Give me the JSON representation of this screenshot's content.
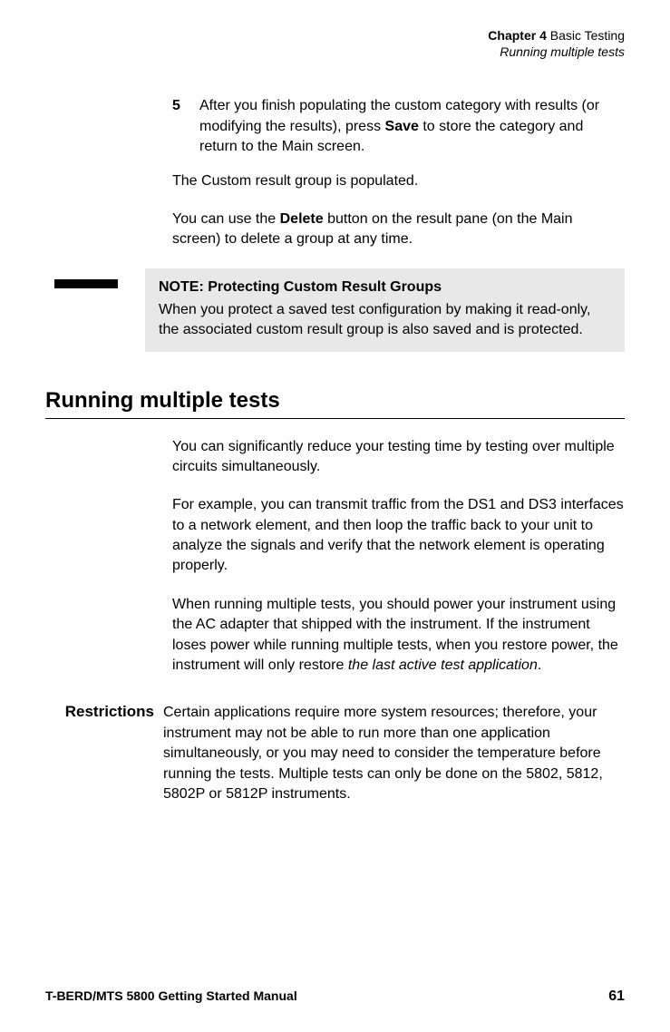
{
  "header": {
    "chapter_label": "Chapter 4",
    "chapter_title": "Basic Testing",
    "section_title": "Running multiple tests"
  },
  "step5": {
    "number": "5",
    "text_before_save": "After you finish populating the custom category with results (or modifying the results), press ",
    "save_word": "Save",
    "text_after_save": " to store the category and return to the Main screen."
  },
  "populated_text": "The Custom result group is populated.",
  "delete_para": {
    "before": "You can use the ",
    "delete_word": "Delete",
    "after": " button on the result pane (on the Main screen) to delete a group at any time."
  },
  "note": {
    "title": "NOTE: Protecting Custom Result Groups",
    "body": "When you protect a saved test configuration by making it read-only, the associated custom result group is also saved and is protected."
  },
  "section_heading": "Running multiple tests",
  "intro_para": "You can significantly reduce your testing time by testing over multiple circuits simultaneously.",
  "example_para": "For example, you can transmit traffic from the DS1 and DS3 interfaces to a network element, and then loop the traffic back to your unit to analyze the signals and verify that the network element is operating properly.",
  "power_para": {
    "before": "When running multiple tests, you should power your instrument using the AC adapter that shipped with the instrument. If the instrument loses power while running multiple tests, when you restore power, the instrument will only restore ",
    "italic": "the last active test application",
    "after": "."
  },
  "restrictions": {
    "label": "Restrictions",
    "text": "Certain applications require more system resources; therefore, your instrument may not be able to run more than one application simultaneously, or you may need to consider the temperature before running the tests. Multiple tests can only be done on the 5802, 5812, 5802P or 5812P instruments."
  },
  "footer": {
    "manual_title": "T-BERD/MTS 5800 Getting Started Manual",
    "page_number": "61"
  }
}
